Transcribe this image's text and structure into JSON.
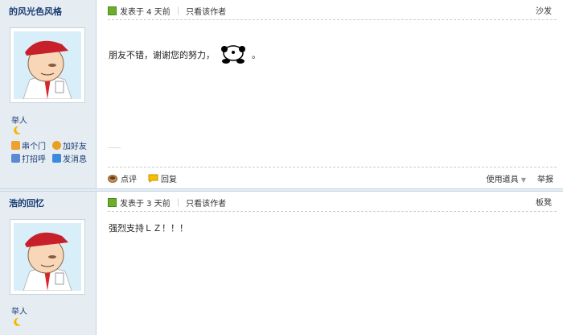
{
  "posts": [
    {
      "author": "的风光色风格",
      "rank": "举人",
      "links": [
        "串个门",
        "加好友",
        "打招呼",
        "发消息"
      ],
      "posted": "发表于 4 天前",
      "only_author": "只看该作者",
      "floor": "沙发",
      "message_before": "朋友不错，谢谢您的努力，",
      "message_after": "。",
      "actions": {
        "comment": "点评",
        "reply": "回复",
        "tools": "使用道具",
        "report": "举报"
      }
    },
    {
      "author": "浩的回忆",
      "rank": "举人",
      "posted": "发表于 3 天前",
      "only_author": "只看该作者",
      "floor": "板凳",
      "message": "强烈支持ＬＺ！！！"
    }
  ],
  "colors": {
    "sidebar_bg": "#e5edf2",
    "author": "#1c3d74",
    "border": "#c2d5e3"
  }
}
